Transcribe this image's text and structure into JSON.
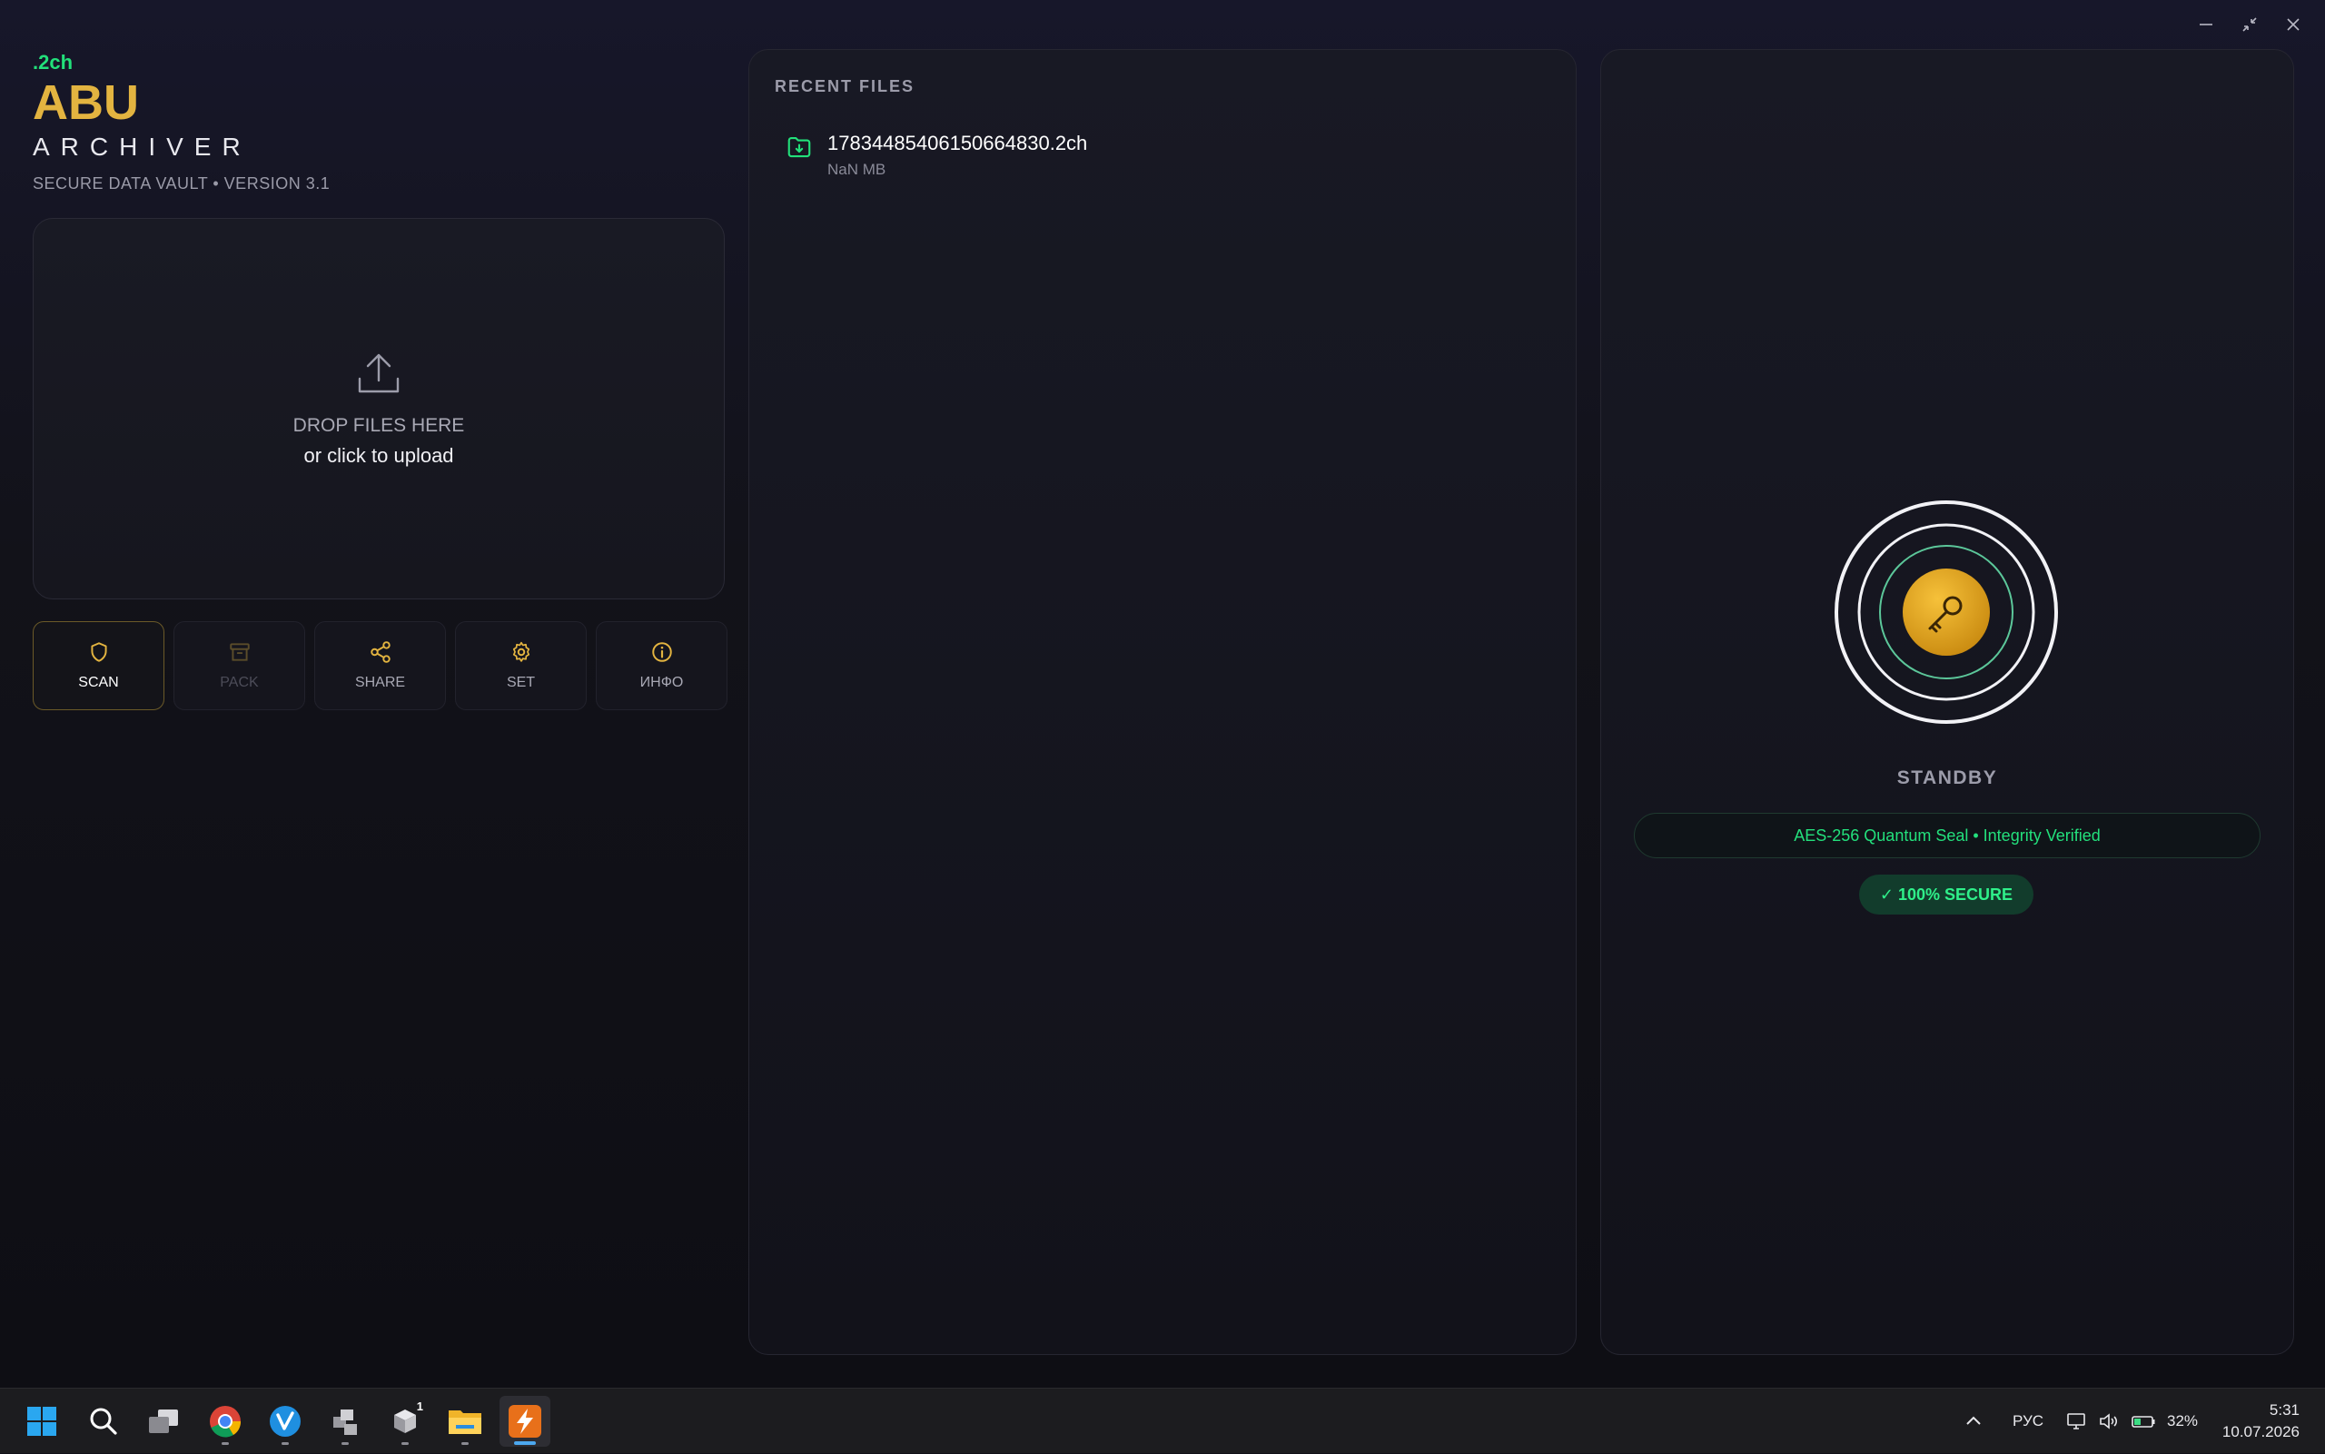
{
  "brand": {
    "ext": ".2ch",
    "name": "ABU",
    "subtitle": "ARCHIVER",
    "tagline": "SECURE DATA VAULT • VERSION 3.1"
  },
  "dropzone": {
    "title": "DROP FILES HERE",
    "subtitle": "or click to upload",
    "icon": "upload-icon"
  },
  "actions": [
    {
      "label": "SCAN",
      "icon": "shield-icon",
      "state": "active"
    },
    {
      "label": "PACK",
      "icon": "archive-icon",
      "state": "disabled"
    },
    {
      "label": "SHARE",
      "icon": "share-icon",
      "state": "normal"
    },
    {
      "label": "SET",
      "icon": "gear-icon",
      "state": "normal"
    },
    {
      "label": "ИНФО",
      "icon": "info-icon",
      "state": "normal"
    }
  ],
  "recent": {
    "title": "RECENT FILES",
    "files": [
      {
        "name": "17834485406150664830.2ch",
        "size": "NaN MB",
        "icon": "folder-download-icon"
      }
    ]
  },
  "status": {
    "state": "STANDBY",
    "integrity": "AES-256 Quantum Seal • Integrity Verified",
    "badge": "✓ 100% SECURE",
    "icon": "key-icon"
  },
  "colors": {
    "accent_gold": "#e3b440",
    "accent_green": "#22e07a",
    "background": "#121219"
  },
  "taskbar": {
    "apps": [
      "windows-start-icon",
      "search-icon",
      "task-view-icon",
      "chrome-icon",
      "vscode-like-icon",
      "package-icon",
      "cube-icon",
      "file-explorer-icon",
      "archiver-app-icon"
    ],
    "cube_badge": "1",
    "language": "РУС",
    "battery": "32%",
    "time": "5:31",
    "date": "10.07.2026"
  }
}
